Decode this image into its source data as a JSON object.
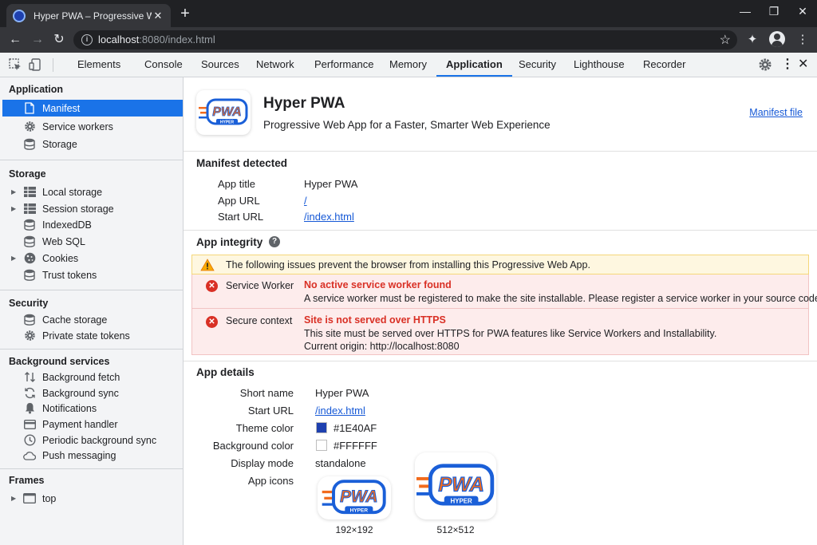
{
  "browser": {
    "tab_title": "Hyper PWA – Progressive Web A",
    "url_host": "localhost",
    "url_rest": ":8080/index.html"
  },
  "devtools": {
    "tabs": [
      "Elements",
      "Console",
      "Sources",
      "Network",
      "Performance",
      "Memory",
      "Application",
      "Security",
      "Lighthouse",
      "Recorder"
    ],
    "active_tab": "Application"
  },
  "sidebar": {
    "application": {
      "title": "Application",
      "items": [
        "Manifest",
        "Service workers",
        "Storage"
      ]
    },
    "storage": {
      "title": "Storage",
      "items": [
        "Local storage",
        "Session storage",
        "IndexedDB",
        "Web SQL",
        "Cookies",
        "Trust tokens"
      ]
    },
    "security": {
      "title": "Security",
      "items": [
        "Cache storage",
        "Private state tokens"
      ]
    },
    "background": {
      "title": "Background services",
      "items": [
        "Background fetch",
        "Background sync",
        "Notifications",
        "Payment handler",
        "Periodic background sync",
        "Push messaging"
      ]
    },
    "frames": {
      "title": "Frames",
      "items": [
        "top"
      ]
    }
  },
  "header": {
    "title": "Hyper PWA",
    "subtitle": "Progressive Web App for a Faster, Smarter Web Experience",
    "manifest_link": "Manifest file",
    "logo_text": "PWA",
    "logo_sub": "HYPER"
  },
  "manifest_detected": {
    "title": "Manifest detected",
    "rows": [
      {
        "key": "App title",
        "value": "Hyper PWA"
      },
      {
        "key": "App URL",
        "value": "/"
      },
      {
        "key": "Start URL",
        "value": "/index.html"
      }
    ]
  },
  "integrity": {
    "title": "App integrity",
    "warning": "The following issues prevent the browser from installing this Progressive Web App.",
    "errors": [
      {
        "label": "Service Worker",
        "title": "No active service worker found",
        "lines": [
          "A service worker must be registered to make the site installable. Please register a service worker in your source code."
        ]
      },
      {
        "label": "Secure context",
        "title": "Site is not served over HTTPS",
        "lines": [
          "This site must be served over HTTPS for PWA features like Service Workers and Installability.",
          "Current origin: http://localhost:8080"
        ]
      }
    ]
  },
  "details": {
    "title": "App details",
    "short_name_key": "Short name",
    "short_name": "Hyper PWA",
    "start_url_key": "Start URL",
    "start_url": "/index.html",
    "theme_color_key": "Theme color",
    "theme_color": "#1E40AF",
    "bg_color_key": "Background color",
    "bg_color": "#FFFFFF",
    "display_key": "Display mode",
    "display": "standalone",
    "icons_key": "App icons",
    "icons": [
      {
        "size": "192×192"
      },
      {
        "size": "512×512"
      }
    ]
  },
  "colors": {
    "accent": "#1a73e8",
    "error": "#d93025",
    "logo_blue": "#1a5fd8",
    "logo_orange": "#f26b1d"
  }
}
